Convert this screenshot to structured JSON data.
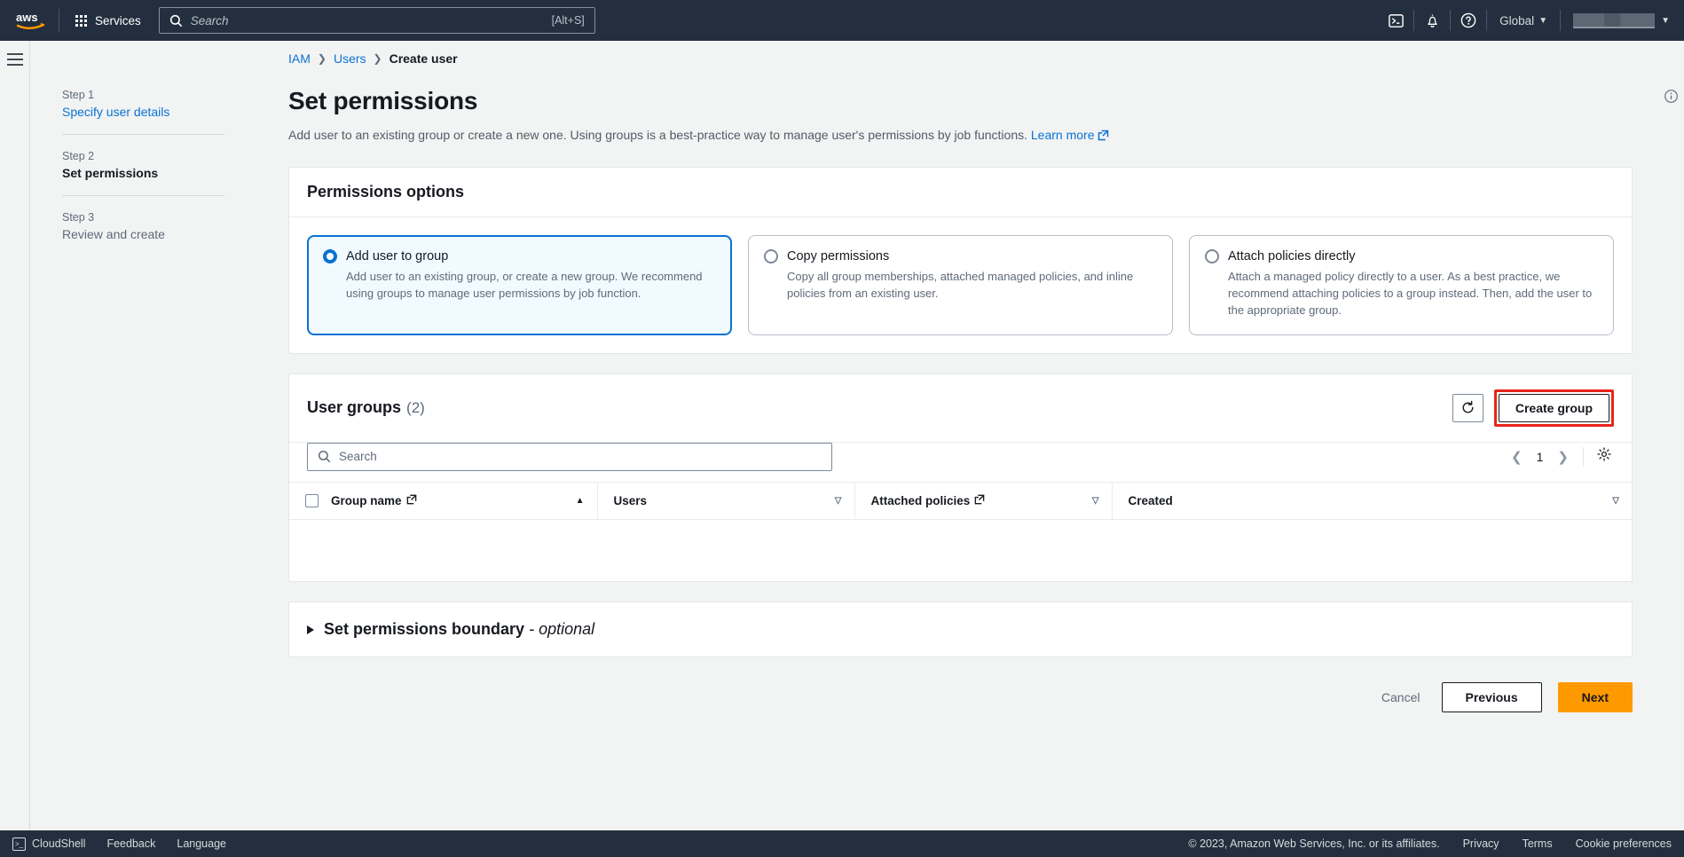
{
  "topnav": {
    "logo_alt": "aws",
    "services_label": "Services",
    "search_placeholder": "Search",
    "search_shortcut": "[Alt+S]",
    "cloudshell_icon": "cloudshell-icon",
    "notifications_icon": "bell-icon",
    "help_icon": "help-circle-icon",
    "region_label": "Global",
    "account_label": ""
  },
  "breadcrumb": {
    "items": [
      {
        "label": "IAM",
        "link": true
      },
      {
        "label": "Users",
        "link": true
      },
      {
        "label": "Create user",
        "link": false
      }
    ],
    "separator": "❯"
  },
  "wizard": {
    "steps": [
      {
        "num": "Step 1",
        "label": "Specify user details",
        "state": "link"
      },
      {
        "num": "Step 2",
        "label": "Set permissions",
        "state": "current"
      },
      {
        "num": "Step 3",
        "label": "Review and create",
        "state": "muted"
      }
    ]
  },
  "page": {
    "title": "Set permissions",
    "description": "Add user to an existing group or create a new one. Using groups is a best-practice way to manage user's permissions by job functions.",
    "learn_more": "Learn more"
  },
  "permissions_options": {
    "heading": "Permissions options",
    "tiles": [
      {
        "title": "Add user to group",
        "description": "Add user to an existing group, or create a new group. We recommend using groups to manage user permissions by job function.",
        "selected": true
      },
      {
        "title": "Copy permissions",
        "description": "Copy all group memberships, attached managed policies, and inline policies from an existing user.",
        "selected": false
      },
      {
        "title": "Attach policies directly",
        "description": "Attach a managed policy directly to a user. As a best practice, we recommend attaching policies to a group instead. Then, add the user to the appropriate group.",
        "selected": false
      }
    ]
  },
  "user_groups": {
    "heading": "User groups",
    "count": "(2)",
    "refresh_icon": "refresh-icon",
    "create_group_label": "Create group",
    "create_group_highlight_color": "#e8241a",
    "search_placeholder": "Search",
    "page_number": "1",
    "settings_icon": "gear-icon",
    "columns": [
      {
        "label": "Group name",
        "external_link": true,
        "sort": "asc"
      },
      {
        "label": "Users",
        "external_link": false,
        "sort": "none"
      },
      {
        "label": "Attached policies",
        "external_link": true,
        "sort": "none"
      },
      {
        "label": "Created",
        "external_link": false,
        "sort": "none"
      }
    ],
    "rows": []
  },
  "permissions_boundary": {
    "title": "Set permissions boundary",
    "optional_suffix": "- optional",
    "expanded": false
  },
  "footer_actions": {
    "cancel": "Cancel",
    "previous": "Previous",
    "next": "Next",
    "next_color": "#ff9900"
  },
  "footer": {
    "cloudshell": "CloudShell",
    "feedback": "Feedback",
    "language": "Language",
    "copyright": "© 2023, Amazon Web Services, Inc. or its affiliates.",
    "privacy": "Privacy",
    "terms": "Terms",
    "cookie": "Cookie preferences"
  }
}
